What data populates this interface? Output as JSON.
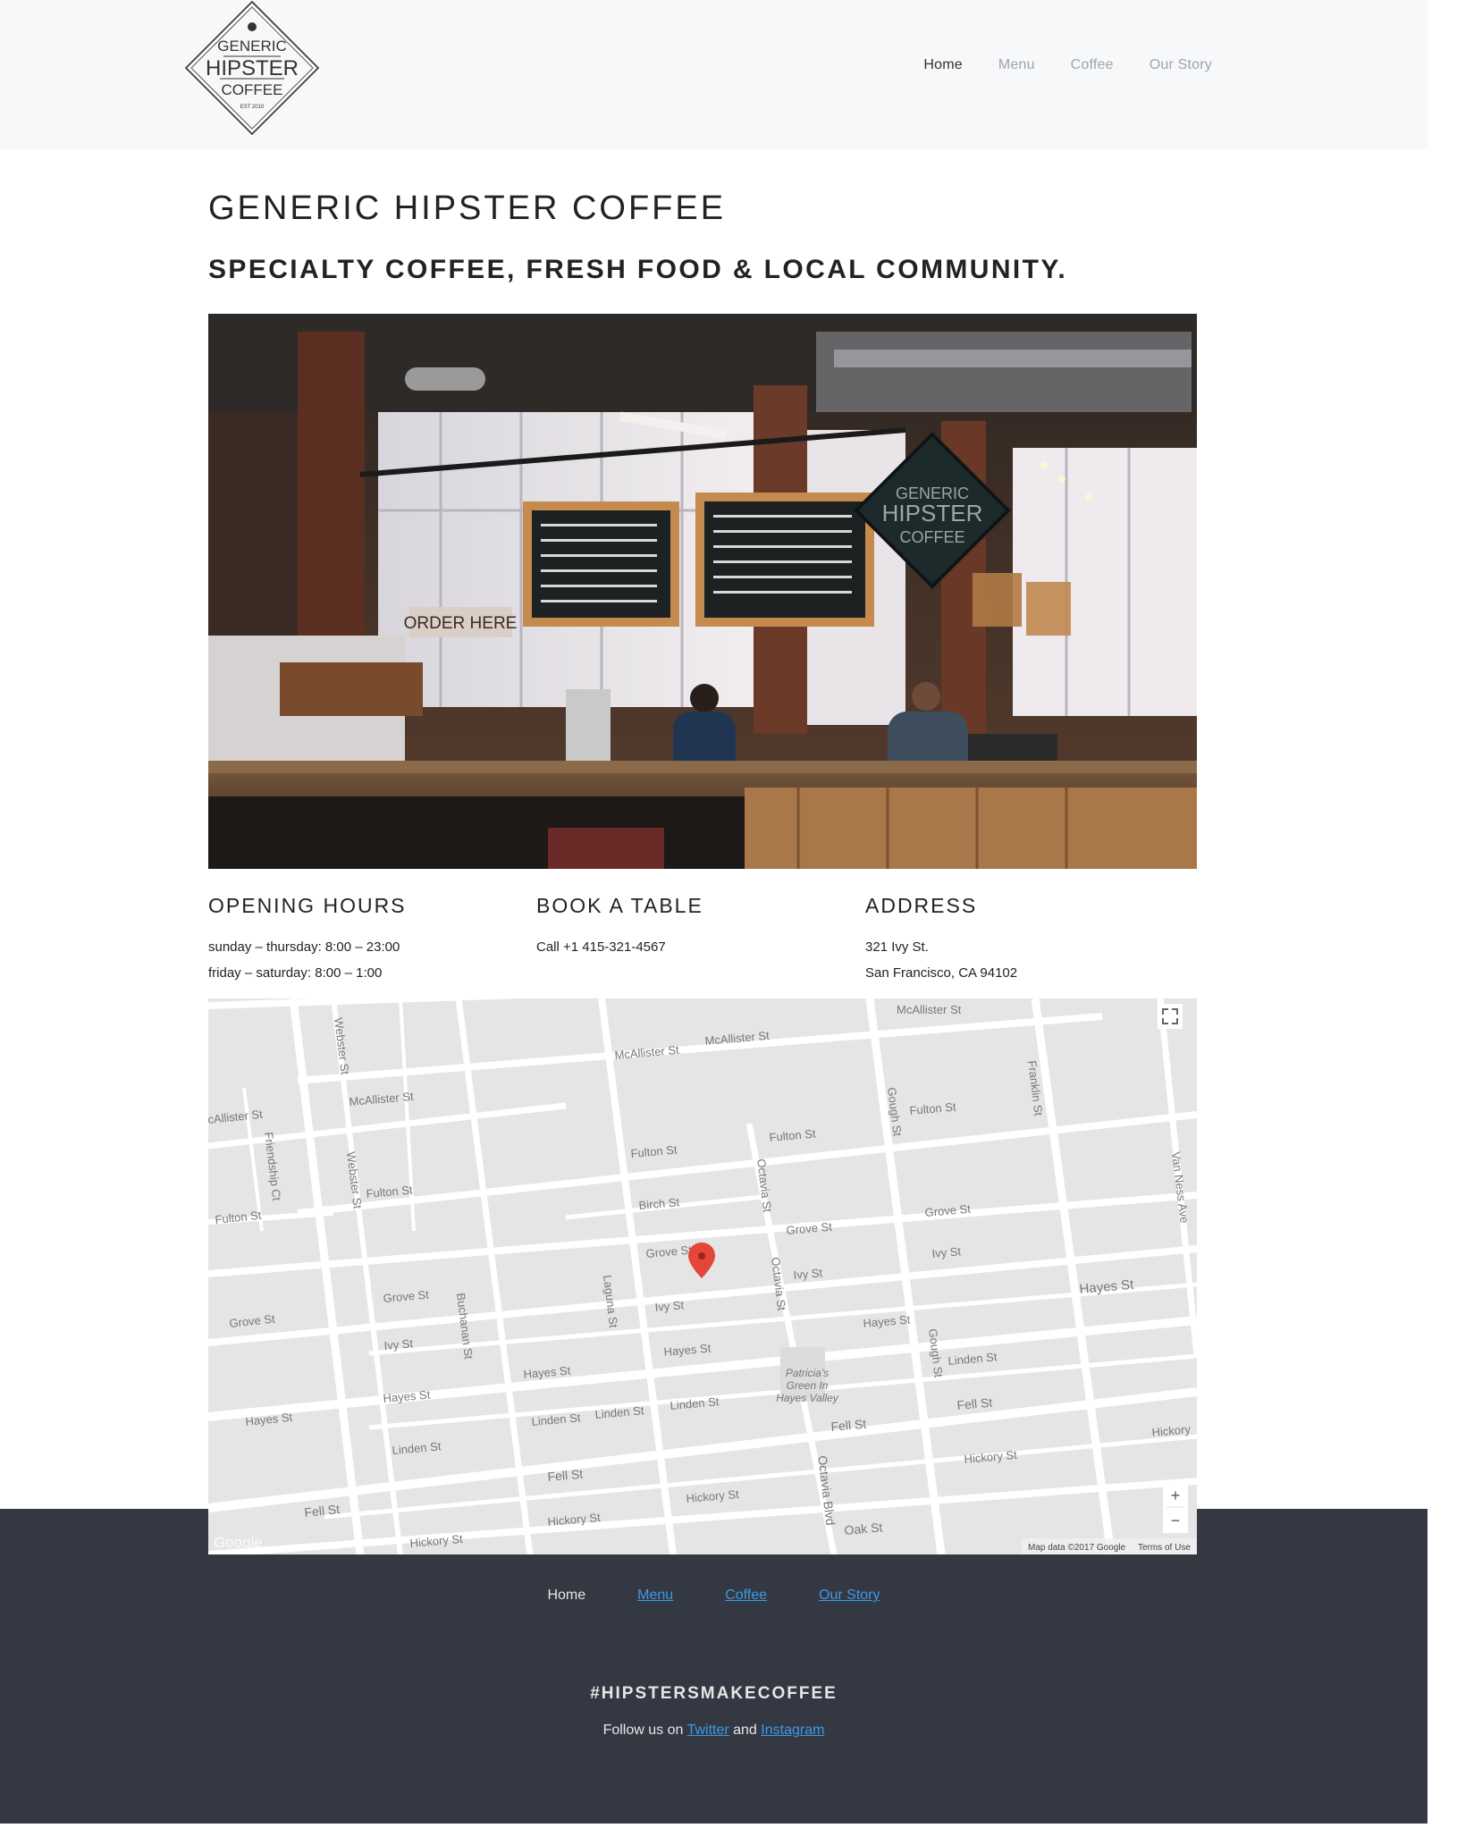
{
  "header": {
    "logo": {
      "line1": "GENERIC",
      "line2": "HIPSTER",
      "line3": "COFFEE",
      "est": "EST 2010"
    },
    "nav": [
      {
        "label": "Home",
        "active": true
      },
      {
        "label": "Menu",
        "active": false
      },
      {
        "label": "Coffee",
        "active": false
      },
      {
        "label": "Our Story",
        "active": false
      }
    ]
  },
  "main": {
    "title": "GENERIC HIPSTER COFFEE",
    "subtitle": "SPECIALTY COFFEE, FRESH FOOD & LOCAL COMMUNITY.",
    "hero": {
      "sign_text": [
        "GENERIC",
        "HIPSTER",
        "COFFEE"
      ],
      "order_sign": "ORDER HERE"
    },
    "opening_hours": {
      "heading": "OPENING HOURS",
      "line1": "sunday – thursday: 8:00 – 23:00",
      "line2": "friday – saturday: 8:00 – 1:00"
    },
    "book_table": {
      "heading": "BOOK A TABLE",
      "line1": "Call +1 415-321-4567"
    },
    "address": {
      "heading": "ADDRESS",
      "line1": "321 Ivy St.",
      "line2": "San Francisco, CA 94102"
    }
  },
  "map": {
    "attribution": "Map data ©2017 Google",
    "terms": "Terms of Use",
    "google": "Google",
    "zoom_in": "+",
    "zoom_out": "−",
    "marker_color": "#e5453a",
    "park_label": [
      "Patricia's",
      "Green In",
      "Hayes Valley"
    ]
  },
  "footer": {
    "nav": [
      {
        "label": "Home",
        "link": false
      },
      {
        "label": "Menu",
        "link": true
      },
      {
        "label": "Coffee",
        "link": true
      },
      {
        "label": "Our Story",
        "link": true
      }
    ],
    "hashtag": "#HIPSTERSMAKECOFFEE",
    "follow_prefix": "Follow us on ",
    "twitter": "Twitter",
    "and": " and ",
    "instagram": "Instagram"
  },
  "colors": {
    "header_bg": "#f7f8f9",
    "footer_bg": "#343842",
    "link": "#3b9be8"
  }
}
